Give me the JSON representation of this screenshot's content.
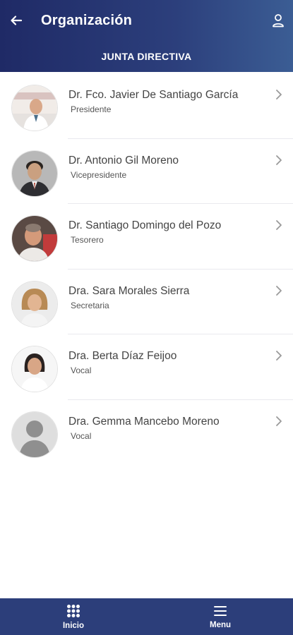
{
  "header": {
    "title": "Organización",
    "section": "JUNTA DIRECTIVA"
  },
  "members": [
    {
      "name": "Dr. Fco. Javier De Santiago García",
      "role": "Presidente"
    },
    {
      "name": "Dr. Antonio Gil Moreno",
      "role": "Vicepresidente"
    },
    {
      "name": "Dr. Santiago Domingo del Pozo",
      "role": "Tesorero"
    },
    {
      "name": "Dra. Sara Morales Sierra",
      "role": "Secretaria"
    },
    {
      "name": "Dra. Berta Díaz Feijoo",
      "role": "Vocal"
    },
    {
      "name": "Dra. Gemma Mancebo Moreno",
      "role": "Vocal"
    }
  ],
  "bottom_nav": {
    "inicio_label": "Inicio",
    "menu_label": "Menu"
  },
  "colors": {
    "header_start": "#1f2a66",
    "header_end": "#3b5d94",
    "bottom_bar": "#2c3e7a"
  },
  "icons": {
    "back": "arrow-left-icon",
    "user": "user-icon",
    "chevron": "chevron-right-icon",
    "inicio": "grid-icon",
    "menu": "hamburger-icon"
  }
}
